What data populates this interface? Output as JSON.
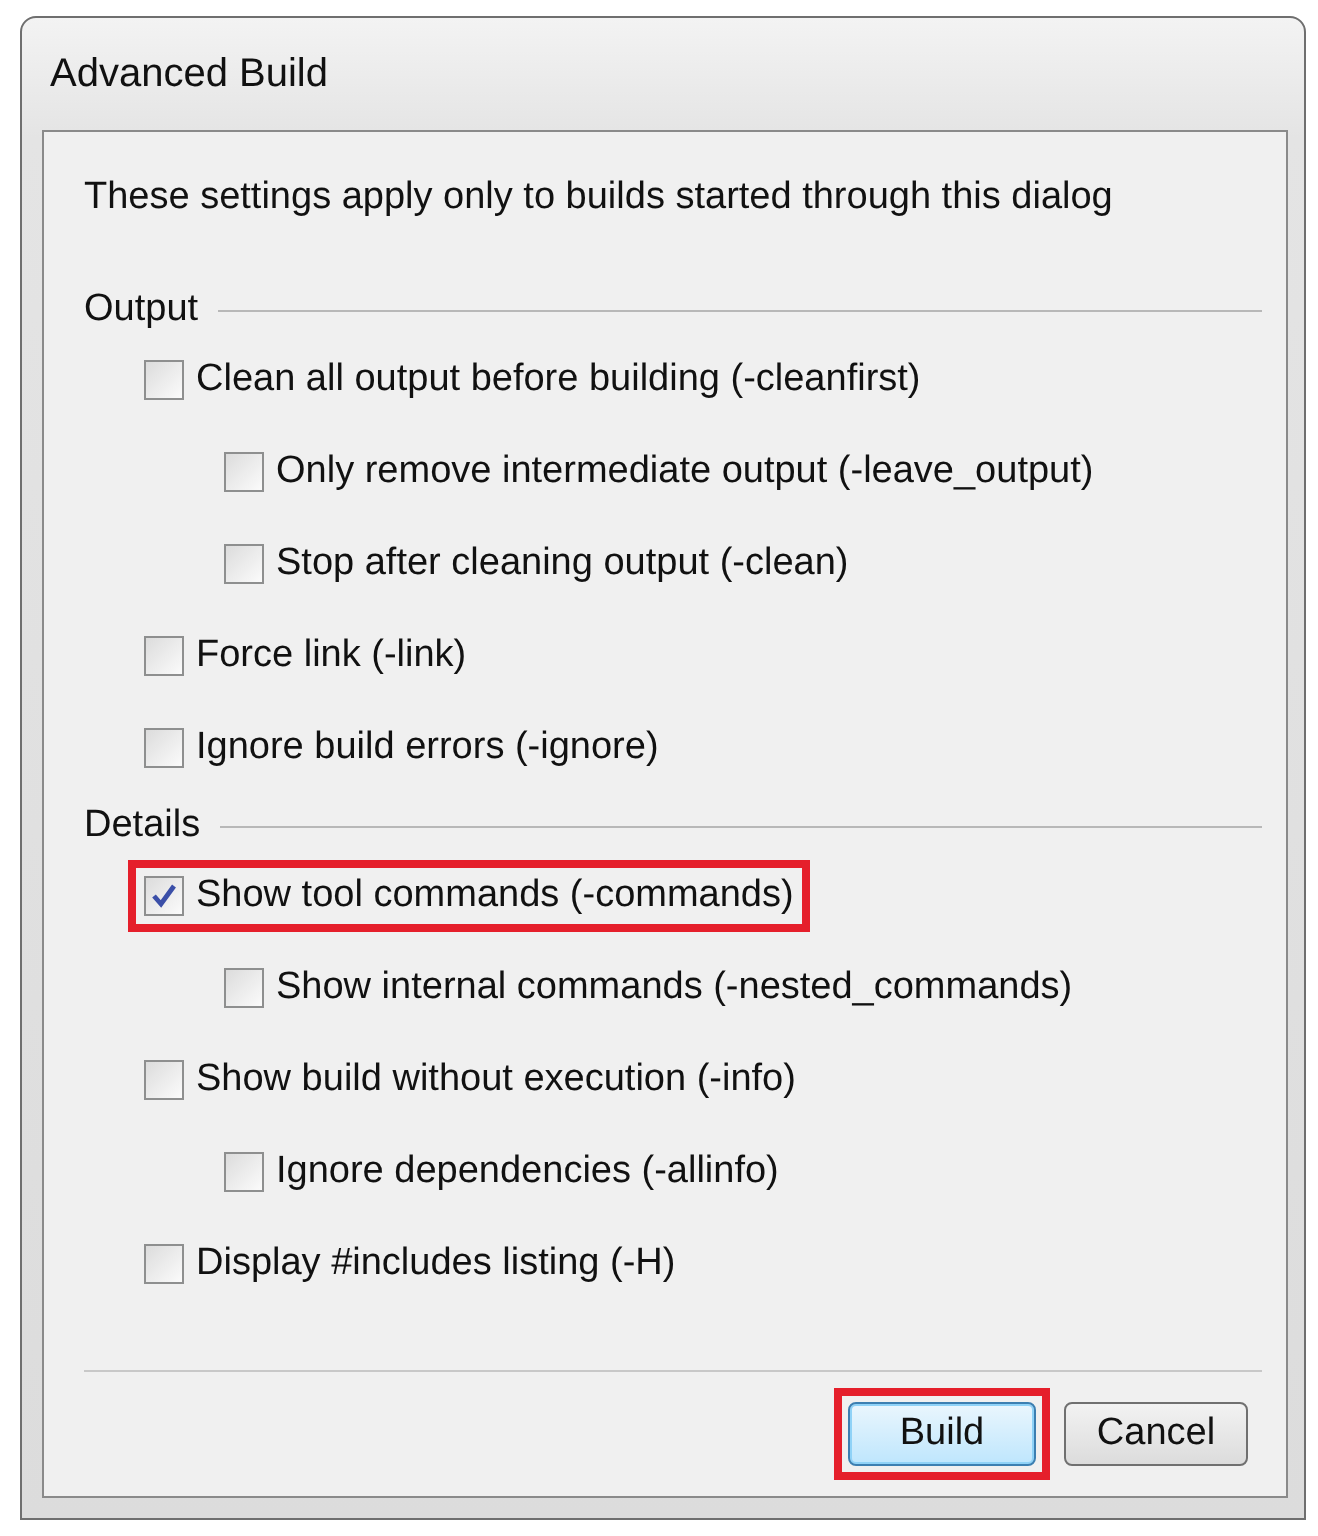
{
  "window": {
    "title": "Advanced Build"
  },
  "intro": "These settings apply only to builds started through this dialog",
  "groups": [
    {
      "label": "Output",
      "options": [
        {
          "label": "Clean all output before building (-cleanfirst)",
          "checked": false,
          "highlighted": false,
          "children": [
            {
              "label": "Only remove intermediate output (-leave_output)",
              "checked": false,
              "highlighted": false
            },
            {
              "label": "Stop after cleaning output (-clean)",
              "checked": false,
              "highlighted": false
            }
          ]
        },
        {
          "label": "Force link (-link)",
          "checked": false,
          "highlighted": false
        },
        {
          "label": "Ignore build errors (-ignore)",
          "checked": false,
          "highlighted": false
        }
      ]
    },
    {
      "label": "Details",
      "options": [
        {
          "label": "Show tool commands (-commands)",
          "checked": true,
          "highlighted": true,
          "children": [
            {
              "label": "Show internal commands (-nested_commands)",
              "checked": false,
              "highlighted": false
            }
          ]
        },
        {
          "label": "Show build without execution (-info)",
          "checked": false,
          "highlighted": false,
          "children": [
            {
              "label": "Ignore dependencies (-allinfo)",
              "checked": false,
              "highlighted": false
            }
          ]
        },
        {
          "label": "Display #includes listing (-H)",
          "checked": false,
          "highlighted": false
        }
      ]
    }
  ],
  "buttons": [
    {
      "label": "Build",
      "default": true,
      "highlighted": true
    },
    {
      "label": "Cancel",
      "default": false,
      "highlighted": false
    }
  ]
}
